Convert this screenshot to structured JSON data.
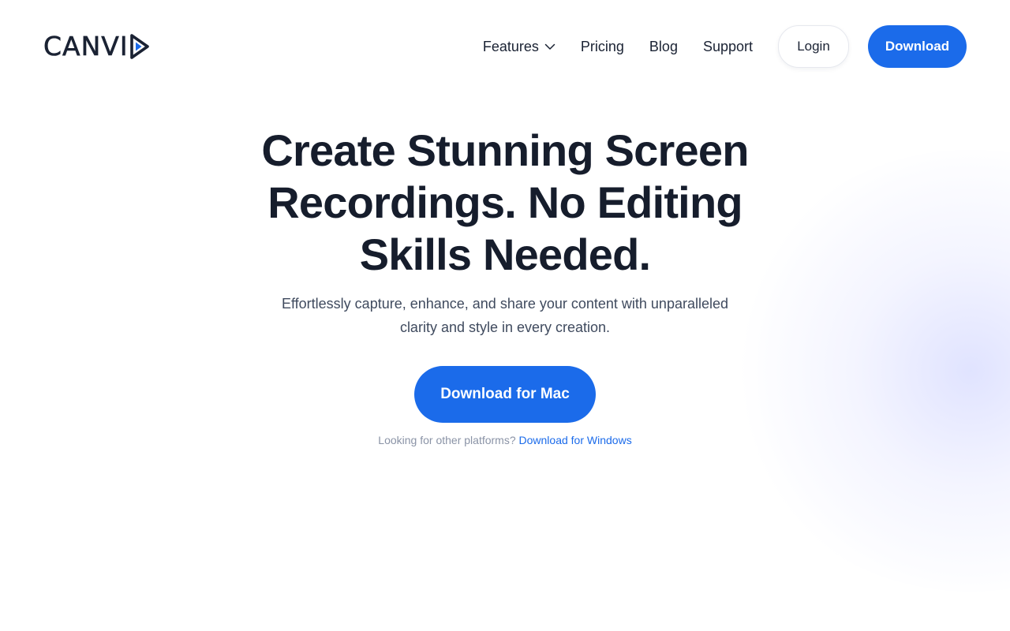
{
  "brand": {
    "name": "CANVI",
    "logo_icon": "play-triangle-icon",
    "accent_color": "#1b6bea"
  },
  "nav": {
    "items": [
      {
        "label": "Features",
        "has_dropdown": true
      },
      {
        "label": "Pricing"
      },
      {
        "label": "Blog"
      },
      {
        "label": "Support"
      }
    ],
    "login_label": "Login",
    "download_label": "Download"
  },
  "hero": {
    "title_lines": [
      "Create Stunning Screen",
      "Recordings. No Editing",
      "Skills Needed."
    ],
    "subtitle_lines": [
      "Effortlessly capture, enhance, and share your content with unparalleled",
      "clarity and style in every creation."
    ],
    "primary_cta": "Download for Mac",
    "other_prefix": "Looking for other platforms?",
    "other_link": "Download for Windows"
  }
}
